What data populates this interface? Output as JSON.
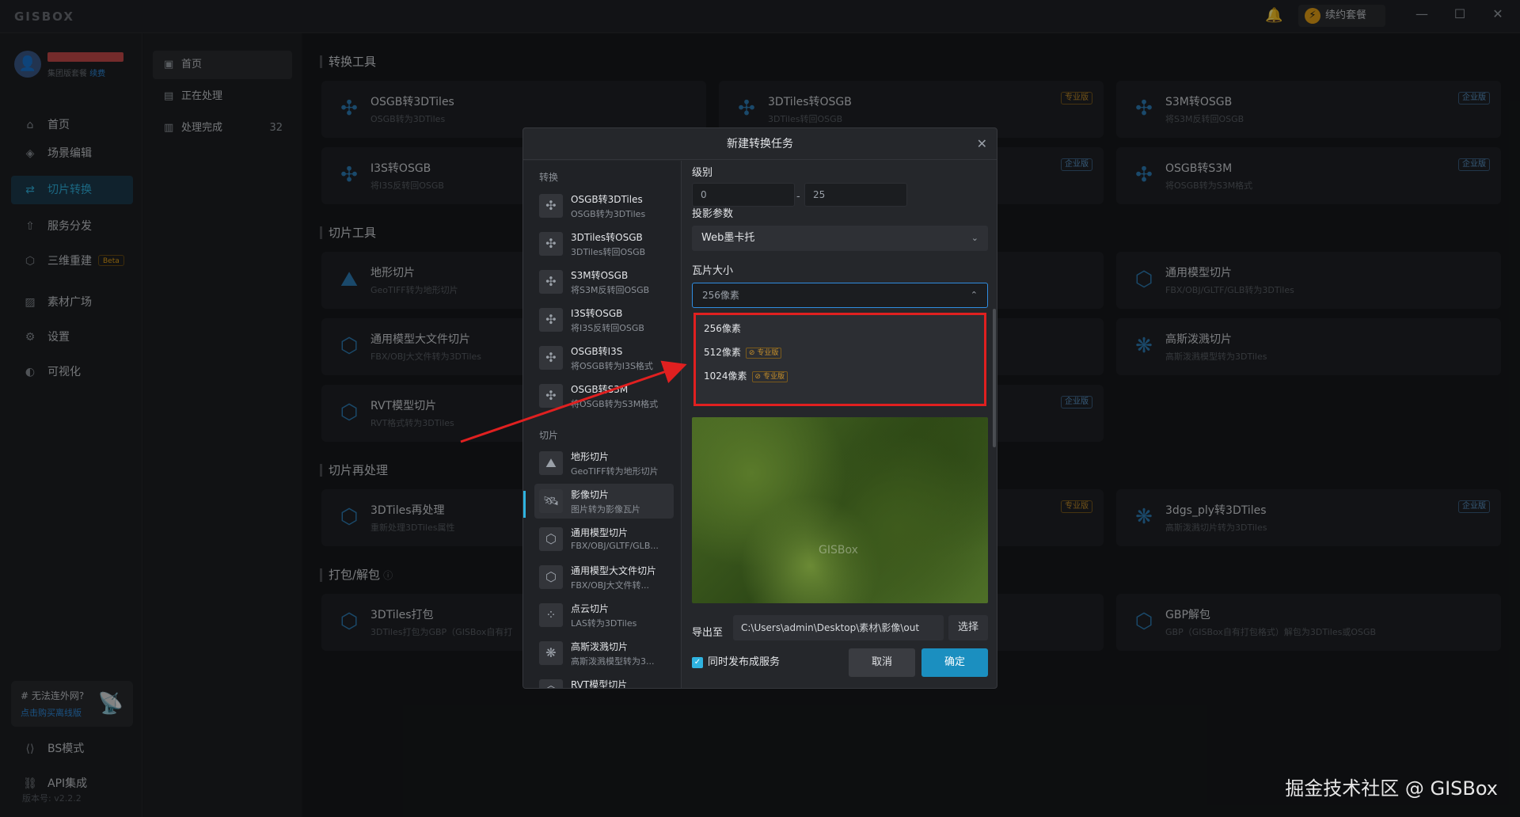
{
  "app": {
    "logo": "GISBOX",
    "renew_label": "续约套餐",
    "renew_icon": "lightning-icon"
  },
  "window": {
    "minimize": "—",
    "maximize": "☐",
    "close": "✕"
  },
  "user": {
    "plan_text": "集团版套餐",
    "renew_link": "续费"
  },
  "sidebar": {
    "items": [
      {
        "label": "首页",
        "icon": "home-icon"
      },
      {
        "label": "场景编辑",
        "icon": "cube-icon"
      },
      {
        "label": "切片转换",
        "icon": "convert-icon",
        "active": true
      },
      {
        "label": "服务分发",
        "icon": "upload-icon"
      },
      {
        "label": "三维重建",
        "icon": "3d-icon",
        "badge": "Beta"
      },
      {
        "label": "素材广场",
        "icon": "image-icon"
      },
      {
        "label": "设置",
        "icon": "gear-icon"
      },
      {
        "label": "可视化",
        "icon": "chart-icon"
      }
    ],
    "network": {
      "title": "# 无法连外网?",
      "link": "点击购买离线版"
    },
    "bottom": [
      {
        "label": "BS模式"
      },
      {
        "label": "API集成"
      }
    ],
    "version": "版本号: v2.2.2"
  },
  "subnav": {
    "items": [
      {
        "label": "首页"
      },
      {
        "label": "正在处理"
      },
      {
        "label": "处理完成",
        "count": "32"
      }
    ]
  },
  "main": {
    "sections": [
      "转换工具",
      "切片工具",
      "切片再处理",
      "打包/解包"
    ],
    "cards": {
      "osgb3d": {
        "title": "OSGB转3DTiles",
        "sub": "OSGB转为3DTiles"
      },
      "tiles_osgb": {
        "title": "3DTiles转OSGB",
        "sub": "3DTiles转回OSGB",
        "badge": "专业版"
      },
      "s3m_osgb": {
        "title": "S3M转OSGB",
        "sub": "将S3M反转回OSGB",
        "badge": "企业版"
      },
      "i3s_osgb": {
        "title": "I3S转OSGB",
        "sub": "将I3S反转回OSGB"
      },
      "osgb_s3m_badge": "企业版",
      "osgb_s3m": {
        "title": "OSGB转S3M",
        "sub": "将OSGB转为S3M格式",
        "badge": "企业版"
      },
      "terrain": {
        "title": "地形切片",
        "sub": "GeoTIFF转为地形切片"
      },
      "model": {
        "title": "通用模型切片",
        "sub": "FBX/OBJ/GLTF/GLB转为3DTiles"
      },
      "bigmodel": {
        "title": "通用模型大文件切片",
        "sub": "FBX/OBJ大文件转为3DTiles"
      },
      "gauss": {
        "title": "高斯泼溅切片",
        "sub": "高斯泼溅模型转为3DTiles"
      },
      "rvt": {
        "title": "RVT模型切片",
        "sub": "RVT格式转为3DTiles"
      },
      "rvt_badge": "企业版",
      "reproc": {
        "title": "3DTiles再处理",
        "sub": "重新处理3DTiles属性"
      },
      "reproc_badge": "专业版",
      "ply": {
        "title": "3dgs_ply转3DTiles",
        "sub": "高斯泼溅切片转为3DTiles",
        "badge": "企业版"
      },
      "pack": {
        "title": "3DTiles打包",
        "sub": "3DTiles打包为GBP（GISBox自有打"
      },
      "unpack": {
        "title": "GBP解包",
        "sub": "GBP（GISBox自有打包格式）解包为3DTiles或OSGB"
      }
    }
  },
  "dialog": {
    "title": "新建转换任务",
    "group_convert": "转换",
    "group_slice": "切片",
    "tools": [
      {
        "title": "OSGB转3DTiles",
        "sub": "OSGB转为3DTiles"
      },
      {
        "title": "3DTiles转OSGB",
        "sub": "3DTiles转回OSGB"
      },
      {
        "title": "S3M转OSGB",
        "sub": "将S3M反转回OSGB"
      },
      {
        "title": "I3S转OSGB",
        "sub": "将I3S反转回OSGB"
      },
      {
        "title": "OSGB转I3S",
        "sub": "将OSGB转为I3S格式"
      },
      {
        "title": "OSGB转S3M",
        "sub": "将OSGB转为S3M格式"
      },
      {
        "title": "地形切片",
        "sub": "GeoTIFF转为地形切片"
      },
      {
        "title": "影像切片",
        "sub": "图片转为影像瓦片",
        "selected": true
      },
      {
        "title": "通用模型切片",
        "sub": "FBX/OBJ/GLTF/GLB..."
      },
      {
        "title": "通用模型大文件切片",
        "sub": "FBX/OBJ大文件转..."
      },
      {
        "title": "点云切片",
        "sub": "LAS转为3DTiles"
      },
      {
        "title": "高斯泼溅切片",
        "sub": "高斯泼溅模型转为3..."
      },
      {
        "title": "RVT模型切片",
        "sub": ""
      }
    ],
    "level_label": "级别",
    "level_min": "0",
    "level_max": "25",
    "projection_label": "投影参数",
    "projection_value": "Web墨卡托",
    "tile_size_label": "瓦片大小",
    "tile_size_value": "256像素",
    "tile_options": [
      {
        "label": "256像素"
      },
      {
        "label": "512像素",
        "badge": "专业版"
      },
      {
        "label": "1024像素",
        "badge": "专业版"
      }
    ],
    "preview_watermark": "GISBox",
    "export_label": "导出至",
    "export_path": "C:\\Users\\admin\\Desktop\\素材\\影像\\out",
    "choose_label": "选择",
    "publish_label": "同时发布成服务",
    "cancel_label": "取消",
    "ok_label": "确定"
  },
  "watermark": "掘金技术社区 @ GISBox"
}
